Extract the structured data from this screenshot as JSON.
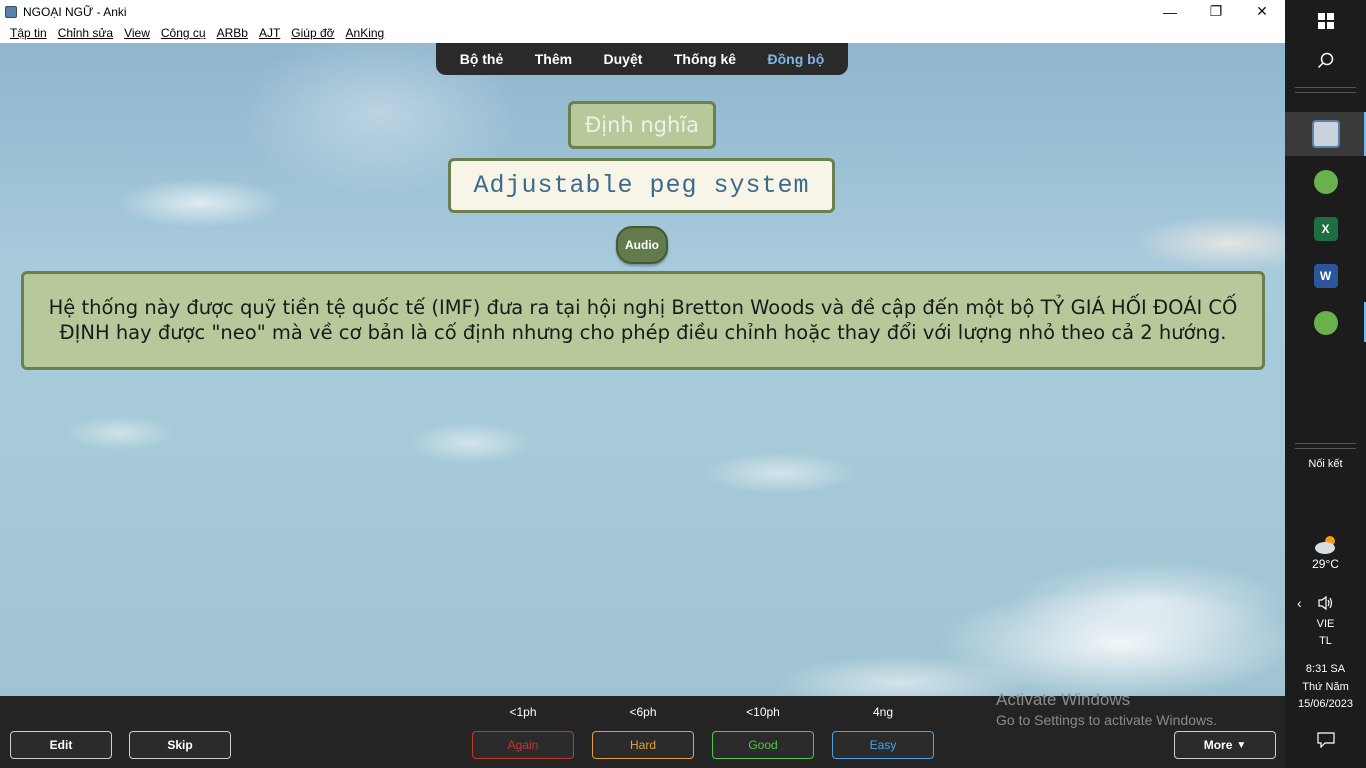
{
  "window": {
    "title": "NGOẠI NGỮ - Anki",
    "controls": {
      "minimize": "—",
      "maximize": "❐",
      "close": "✕"
    }
  },
  "menu": [
    "Tập tin",
    "Chỉnh sửa",
    "View",
    "Công cụ",
    "ARBb",
    "AJT",
    "Giúp đỡ",
    "AnKing"
  ],
  "topnav": {
    "decks": "Bộ thẻ",
    "add": "Thêm",
    "browse": "Duyệt",
    "stats": "Thống kê",
    "sync": "Đồng bộ"
  },
  "card": {
    "type_label": "Định nghĩa",
    "front": "Adjustable peg system",
    "audio_label": "Audio",
    "back": "Hệ thống này được quỹ tiền tệ quốc tế (IMF) đưa ra tại hội nghị Bretton Woods và đề cập đến một bộ TỶ GIÁ HỐI ĐOÁI CỐ ĐỊNH hay được \"neo\" mà về cơ bản là cố định nhưng cho phép điều chỉnh hoặc thay đổi với lượng nhỏ theo cả 2 hướng."
  },
  "bottom": {
    "edit": "Edit",
    "skip": "Skip",
    "more": "More",
    "more_arrow": "▼",
    "answers": [
      {
        "interval": "<1ph",
        "label": "Again",
        "color": "#c0392b"
      },
      {
        "interval": "<6ph",
        "label": "Hard",
        "color": "#e3a03c"
      },
      {
        "interval": "<10ph",
        "label": "Good",
        "color": "#4cc94a"
      },
      {
        "interval": "4ng",
        "label": "Easy",
        "color": "#4aa3e8"
      }
    ]
  },
  "watermark": {
    "line1": "Activate Windows",
    "line2": "Go to Settings to activate Windows."
  },
  "taskbar": {
    "connect": "Nối kết",
    "temperature": "29°C",
    "language": "VIE",
    "input_mode": "TL",
    "time": "8:31 SA",
    "weekday": "Thứ Năm",
    "date": "15/06/2023",
    "icons": [
      "windows-start-icon",
      "search-icon",
      "anki-app-icon",
      "green-app-icon",
      "excel-icon",
      "word-icon",
      "green-app-2-icon",
      "weather-icon",
      "chevron-left-icon",
      "speaker-icon",
      "notification-icon"
    ]
  }
}
